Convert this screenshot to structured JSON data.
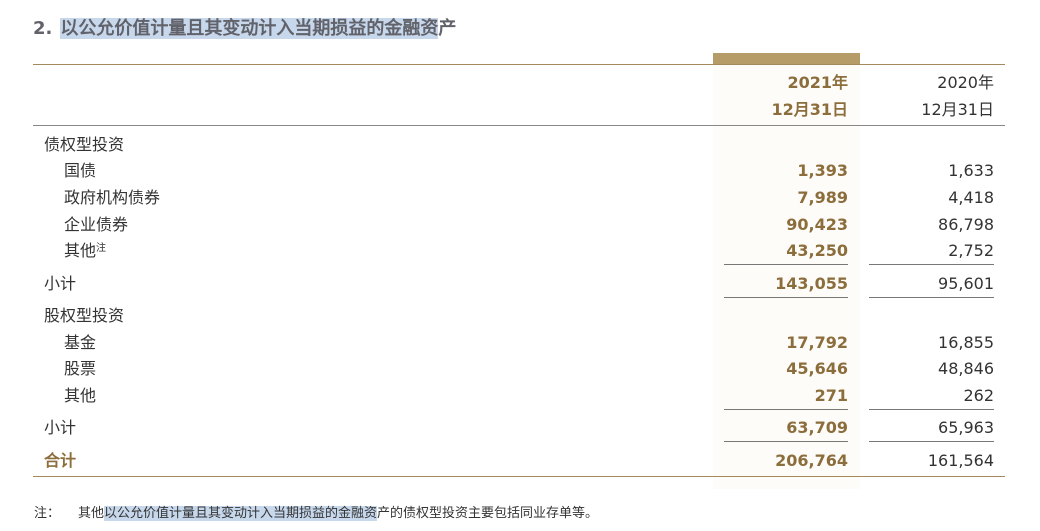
{
  "title": {
    "number": "2.",
    "text_highlighted": "以公允价值计量且其变动计入当期损益的金融资",
    "text_plain": "产"
  },
  "header": {
    "col_2021": {
      "year": "2021年",
      "date": "12月31日"
    },
    "col_2020": {
      "year": "2020年",
      "date": "12月31日"
    }
  },
  "rows": [
    {
      "label": "债权型投资",
      "indent": 1,
      "v2021": "",
      "v2020": ""
    },
    {
      "label": "国债",
      "indent": 2,
      "v2021": "1,393",
      "v2020": "1,633"
    },
    {
      "label": "政府机构债券",
      "indent": 2,
      "v2021": "7,989",
      "v2020": "4,418"
    },
    {
      "label": "企业债券",
      "indent": 2,
      "v2021": "90,423",
      "v2020": "86,798"
    },
    {
      "label": "其他",
      "sup": "注",
      "indent": 2,
      "v2021": "43,250",
      "v2020": "2,752"
    },
    {
      "label": "小计",
      "indent": 1,
      "v2021": "143,055",
      "v2020": "95,601"
    },
    {
      "label": "股权型投资",
      "indent": 1,
      "v2021": "",
      "v2020": ""
    },
    {
      "label": "基金",
      "indent": 2,
      "v2021": "17,792",
      "v2020": "16,855"
    },
    {
      "label": "股票",
      "indent": 2,
      "v2021": "45,646",
      "v2020": "48,846"
    },
    {
      "label": "其他",
      "indent": 2,
      "v2021": "271",
      "v2020": "262"
    },
    {
      "label": "小计",
      "indent": 1,
      "v2021": "63,709",
      "v2020": "65,963"
    },
    {
      "label": "合计",
      "indent": 1,
      "v2021": "206,764",
      "v2020": "161,564"
    }
  ],
  "footnote": {
    "label": "注：",
    "prefix": "其他",
    "highlighted": "以公允价值计量且其变动计入当期损益的金融资",
    "suffix": "产的债权型投资主要包括同业存单等。"
  },
  "colors": {
    "accent_gold": "#b59c68",
    "value_2021": "#8c6d3c",
    "selection_highlight": "#c7d8ec",
    "title_gray": "#61626a"
  }
}
